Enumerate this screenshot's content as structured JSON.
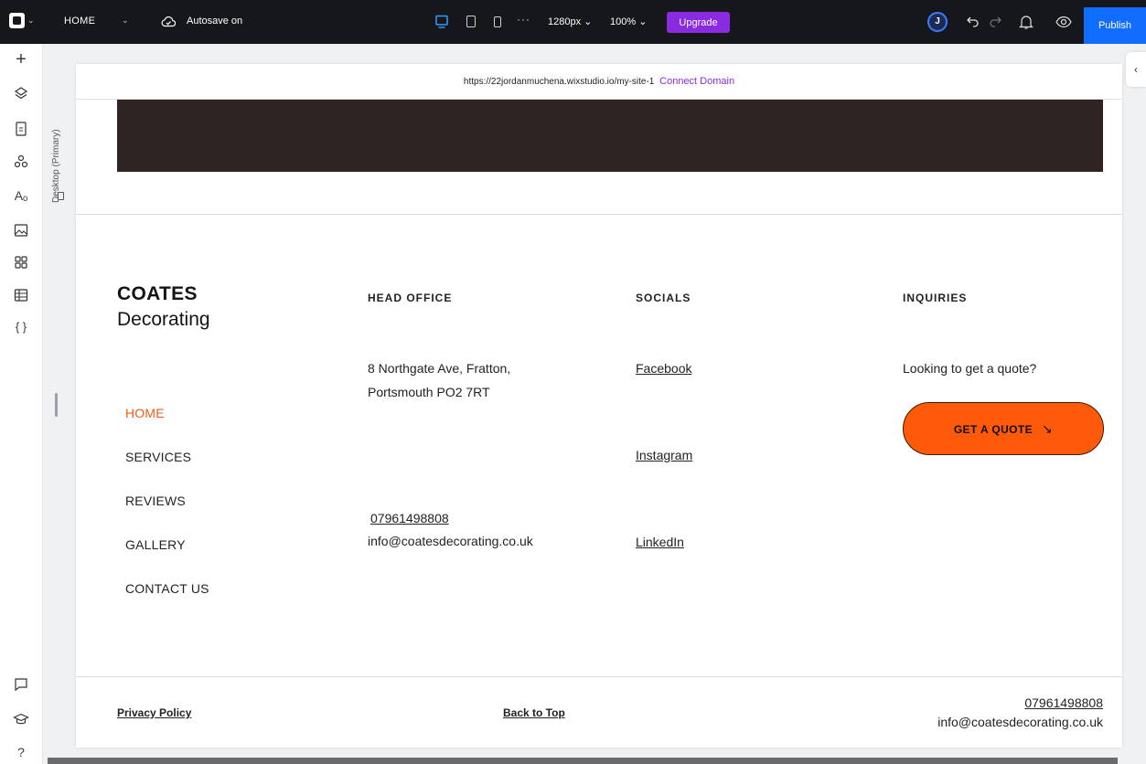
{
  "toolbar": {
    "page_name": "HOME",
    "autosave": "Autosave on",
    "width": "1280px ⌄",
    "zoom": "100% ⌄",
    "upgrade": "Upgrade",
    "avatar_initial": "J",
    "publish": "Publish"
  },
  "canvas": {
    "device_label": "Desktop (Primary)",
    "url": "https://22jordanmuchena.wixstudio.io/my-site-1",
    "connect_domain": "Connect Domain"
  },
  "footer": {
    "brand_line1": "COATES",
    "brand_line2": "Decorating",
    "nav": [
      "HOME",
      "SERVICES",
      "REVIEWS",
      "GALLERY",
      "CONTACT US"
    ],
    "head_office": {
      "heading": "HEAD OFFICE",
      "address1": "8 Northgate Ave, Fratton,",
      "address2": "Portsmouth PO2 7RT",
      "phone": "07961498808",
      "email": "info@coatesdecorating.co.uk"
    },
    "socials": {
      "heading": "SOCIALS",
      "links": [
        "Facebook",
        "Instagram",
        "LinkedIn"
      ]
    },
    "inquiries": {
      "heading": "INQUIRIES",
      "text": "Looking to get a quote?",
      "button": "GET A QUOTE",
      "button_arrow": "↘"
    },
    "bottom": {
      "privacy": "Privacy Policy",
      "back_to_top": "Back to Top",
      "phone": "07961498808",
      "email": "info@coatesdecorating.co.uk"
    }
  },
  "colors": {
    "accent_orange": "#ff5a0a",
    "nav_active": "#f0591b",
    "upgrade_purple": "#8a2be2",
    "publish_blue": "#116dff",
    "banner_dark": "#2e2522"
  }
}
